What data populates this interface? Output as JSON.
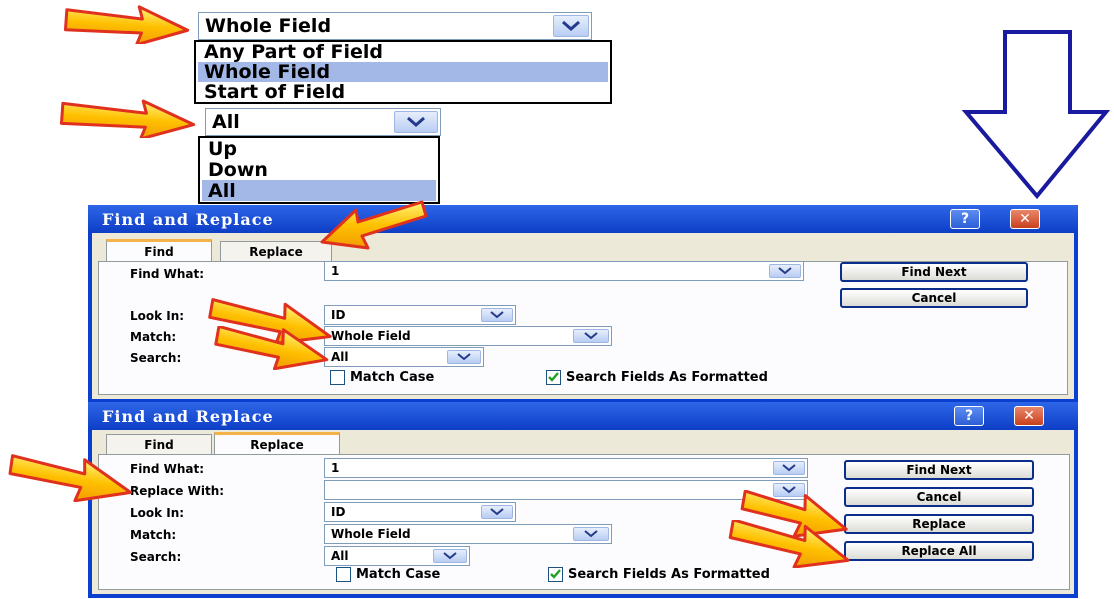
{
  "match_dropdown": {
    "selected": "Whole Field",
    "options": [
      "Any Part of Field",
      "Whole Field",
      "Start of Field"
    ],
    "highlighted": "Whole Field"
  },
  "search_dropdown": {
    "selected": "All",
    "options": [
      "Up",
      "Down",
      "All"
    ],
    "highlighted": "All"
  },
  "dialog_find": {
    "title": "Find and Replace",
    "help": "?",
    "close": "✕",
    "tabs": [
      "Find",
      "Replace"
    ],
    "find_what_label": "Find What:",
    "find_what_value": "1",
    "look_in_label": "Look In:",
    "look_in_value": "ID",
    "match_label": "Match:",
    "match_value": "Whole Field",
    "search_label": "Search:",
    "search_value": "All",
    "match_case": "Match Case",
    "search_formatted": "Search Fields As Formatted",
    "find_next": "Find Next",
    "cancel": "Cancel"
  },
  "dialog_replace": {
    "title": "Find and Replace",
    "help": "?",
    "close": "✕",
    "tabs": [
      "Find",
      "Replace"
    ],
    "find_what_label": "Find What:",
    "find_what_value": "1",
    "replace_with_label": "Replace With:",
    "replace_with_value": "",
    "look_in_label": "Look In:",
    "look_in_value": "ID",
    "match_label": "Match:",
    "match_value": "Whole Field",
    "search_label": "Search:",
    "search_value": "All",
    "match_case": "Match Case",
    "search_formatted": "Search Fields As Formatted",
    "find_next": "Find Next",
    "cancel": "Cancel",
    "replace": "Replace",
    "replace_all": "Replace All"
  },
  "colors": {
    "arrow_fill": "#ffcc00",
    "arrow_outline": "#e0301e",
    "titlebar": "#0d3ec6",
    "outline_arrow": "#1a1a9e"
  }
}
